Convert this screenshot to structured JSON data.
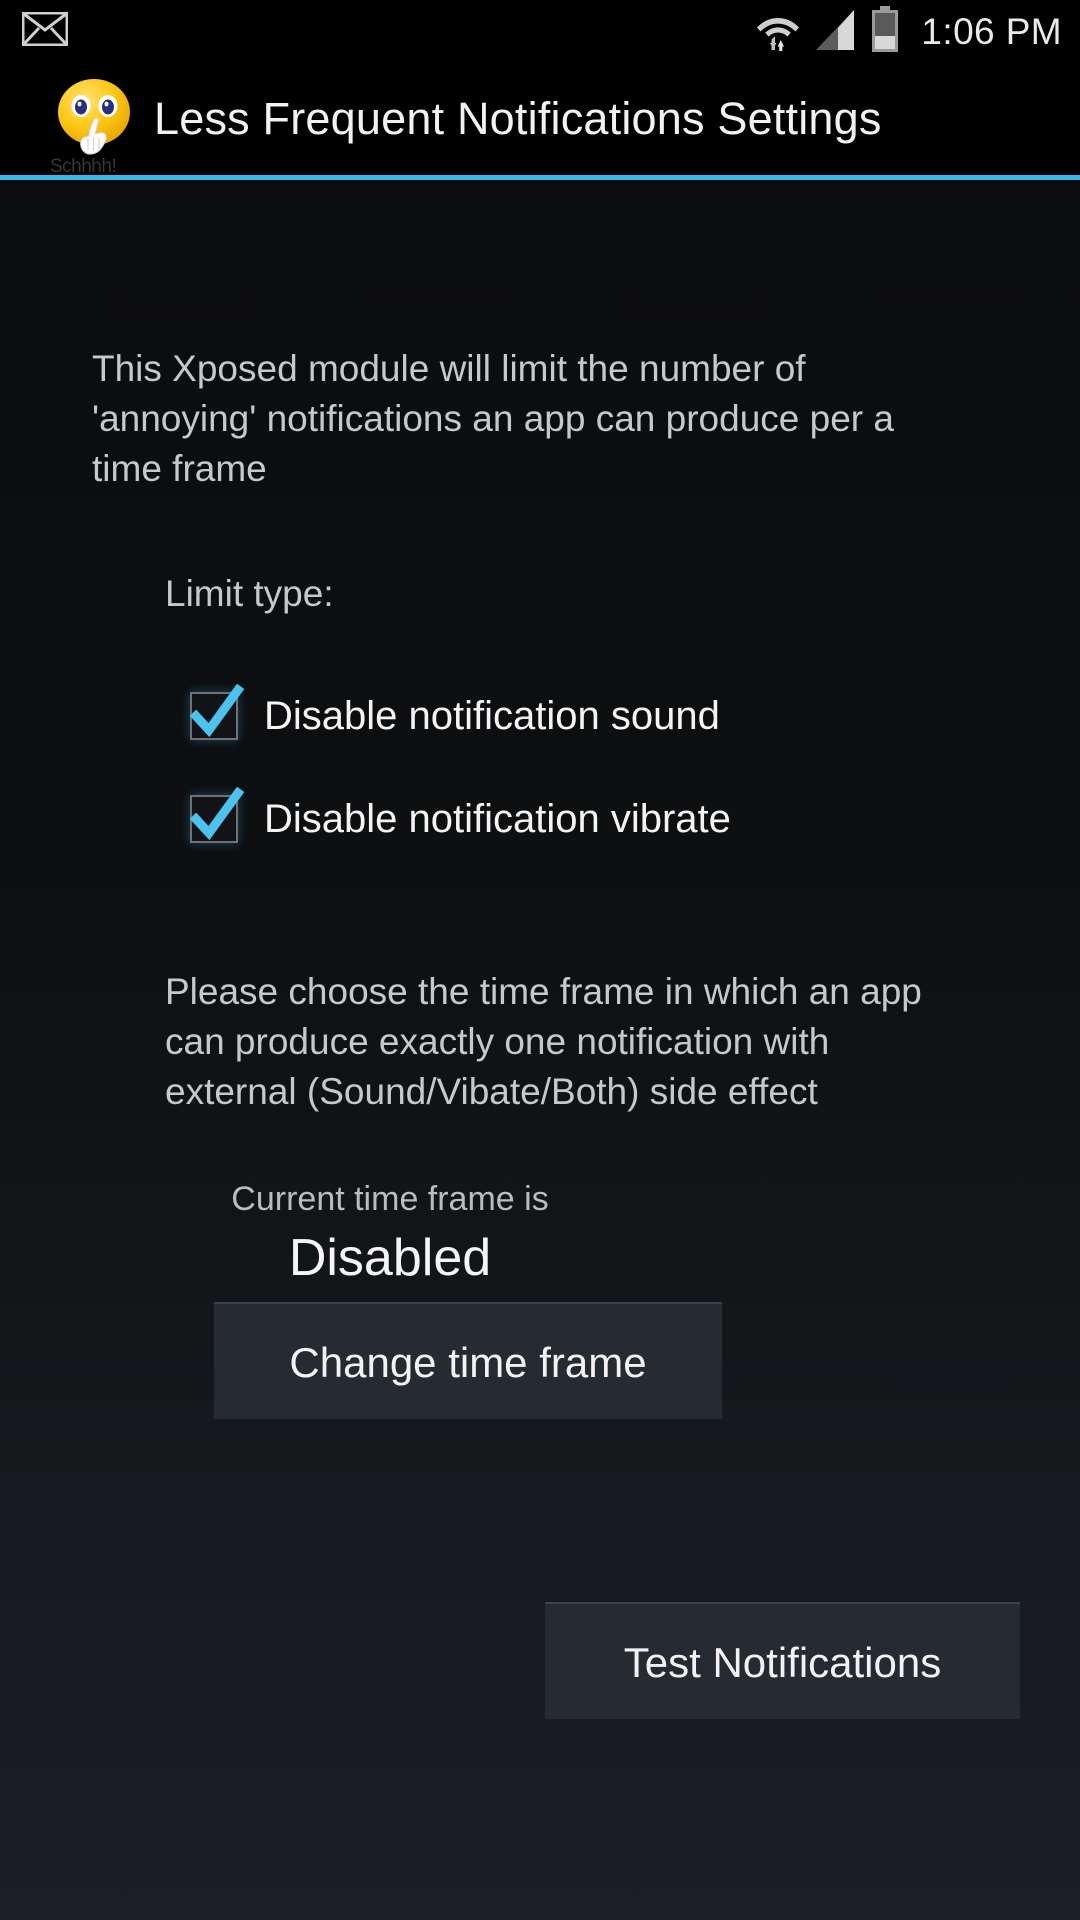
{
  "status_bar": {
    "notification_icon": "envelope-icon",
    "wifi_icon": "wifi-icon",
    "signal_icon": "cellular-signal-icon",
    "battery_icon": "battery-icon",
    "clock": "1:06 PM"
  },
  "title_bar": {
    "app_icon": "shush-smiley-icon",
    "app_icon_caption": "Schhhh!",
    "title": "Less Frequent Notifications Settings",
    "accent_color": "#35b7e8"
  },
  "content": {
    "intro_text": "This Xposed module will limit the number of 'annoying' notifications an app can produce per a time frame",
    "limit_type_label": "Limit type:",
    "checkboxes": [
      {
        "label": "Disable notification sound",
        "checked": true
      },
      {
        "label": "Disable notification vibrate",
        "checked": true
      }
    ],
    "time_frame_description": "Please choose the time frame in which an app can produce exactly one notification with external (Sound/Vibate/Both) side effect",
    "current_time_frame_label": "Current time frame is",
    "current_time_frame_value": "Disabled",
    "change_button_label": "Change time frame",
    "test_button_label": "Test Notifications",
    "checkbox_accent_color": "#4bc3ef",
    "body_text_color": "#c6c8cb"
  }
}
